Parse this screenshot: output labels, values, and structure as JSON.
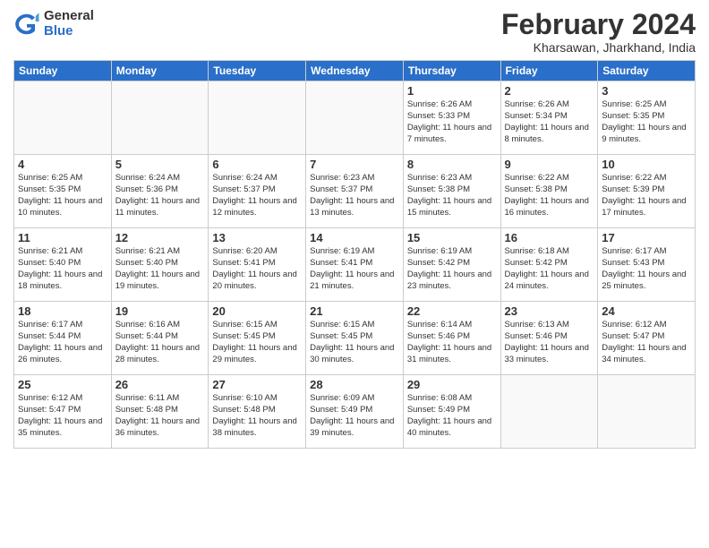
{
  "header": {
    "logo_general": "General",
    "logo_blue": "Blue",
    "main_title": "February 2024",
    "subtitle": "Kharsawan, Jharkhand, India"
  },
  "days_of_week": [
    "Sunday",
    "Monday",
    "Tuesday",
    "Wednesday",
    "Thursday",
    "Friday",
    "Saturday"
  ],
  "weeks": [
    [
      {
        "day": "",
        "info": ""
      },
      {
        "day": "",
        "info": ""
      },
      {
        "day": "",
        "info": ""
      },
      {
        "day": "",
        "info": ""
      },
      {
        "day": "1",
        "info": "Sunrise: 6:26 AM\nSunset: 5:33 PM\nDaylight: 11 hours and 7 minutes."
      },
      {
        "day": "2",
        "info": "Sunrise: 6:26 AM\nSunset: 5:34 PM\nDaylight: 11 hours and 8 minutes."
      },
      {
        "day": "3",
        "info": "Sunrise: 6:25 AM\nSunset: 5:35 PM\nDaylight: 11 hours and 9 minutes."
      }
    ],
    [
      {
        "day": "4",
        "info": "Sunrise: 6:25 AM\nSunset: 5:35 PM\nDaylight: 11 hours and 10 minutes."
      },
      {
        "day": "5",
        "info": "Sunrise: 6:24 AM\nSunset: 5:36 PM\nDaylight: 11 hours and 11 minutes."
      },
      {
        "day": "6",
        "info": "Sunrise: 6:24 AM\nSunset: 5:37 PM\nDaylight: 11 hours and 12 minutes."
      },
      {
        "day": "7",
        "info": "Sunrise: 6:23 AM\nSunset: 5:37 PM\nDaylight: 11 hours and 13 minutes."
      },
      {
        "day": "8",
        "info": "Sunrise: 6:23 AM\nSunset: 5:38 PM\nDaylight: 11 hours and 15 minutes."
      },
      {
        "day": "9",
        "info": "Sunrise: 6:22 AM\nSunset: 5:38 PM\nDaylight: 11 hours and 16 minutes."
      },
      {
        "day": "10",
        "info": "Sunrise: 6:22 AM\nSunset: 5:39 PM\nDaylight: 11 hours and 17 minutes."
      }
    ],
    [
      {
        "day": "11",
        "info": "Sunrise: 6:21 AM\nSunset: 5:40 PM\nDaylight: 11 hours and 18 minutes."
      },
      {
        "day": "12",
        "info": "Sunrise: 6:21 AM\nSunset: 5:40 PM\nDaylight: 11 hours and 19 minutes."
      },
      {
        "day": "13",
        "info": "Sunrise: 6:20 AM\nSunset: 5:41 PM\nDaylight: 11 hours and 20 minutes."
      },
      {
        "day": "14",
        "info": "Sunrise: 6:19 AM\nSunset: 5:41 PM\nDaylight: 11 hours and 21 minutes."
      },
      {
        "day": "15",
        "info": "Sunrise: 6:19 AM\nSunset: 5:42 PM\nDaylight: 11 hours and 23 minutes."
      },
      {
        "day": "16",
        "info": "Sunrise: 6:18 AM\nSunset: 5:42 PM\nDaylight: 11 hours and 24 minutes."
      },
      {
        "day": "17",
        "info": "Sunrise: 6:17 AM\nSunset: 5:43 PM\nDaylight: 11 hours and 25 minutes."
      }
    ],
    [
      {
        "day": "18",
        "info": "Sunrise: 6:17 AM\nSunset: 5:44 PM\nDaylight: 11 hours and 26 minutes."
      },
      {
        "day": "19",
        "info": "Sunrise: 6:16 AM\nSunset: 5:44 PM\nDaylight: 11 hours and 28 minutes."
      },
      {
        "day": "20",
        "info": "Sunrise: 6:15 AM\nSunset: 5:45 PM\nDaylight: 11 hours and 29 minutes."
      },
      {
        "day": "21",
        "info": "Sunrise: 6:15 AM\nSunset: 5:45 PM\nDaylight: 11 hours and 30 minutes."
      },
      {
        "day": "22",
        "info": "Sunrise: 6:14 AM\nSunset: 5:46 PM\nDaylight: 11 hours and 31 minutes."
      },
      {
        "day": "23",
        "info": "Sunrise: 6:13 AM\nSunset: 5:46 PM\nDaylight: 11 hours and 33 minutes."
      },
      {
        "day": "24",
        "info": "Sunrise: 6:12 AM\nSunset: 5:47 PM\nDaylight: 11 hours and 34 minutes."
      }
    ],
    [
      {
        "day": "25",
        "info": "Sunrise: 6:12 AM\nSunset: 5:47 PM\nDaylight: 11 hours and 35 minutes."
      },
      {
        "day": "26",
        "info": "Sunrise: 6:11 AM\nSunset: 5:48 PM\nDaylight: 11 hours and 36 minutes."
      },
      {
        "day": "27",
        "info": "Sunrise: 6:10 AM\nSunset: 5:48 PM\nDaylight: 11 hours and 38 minutes."
      },
      {
        "day": "28",
        "info": "Sunrise: 6:09 AM\nSunset: 5:49 PM\nDaylight: 11 hours and 39 minutes."
      },
      {
        "day": "29",
        "info": "Sunrise: 6:08 AM\nSunset: 5:49 PM\nDaylight: 11 hours and 40 minutes."
      },
      {
        "day": "",
        "info": ""
      },
      {
        "day": "",
        "info": ""
      }
    ]
  ]
}
